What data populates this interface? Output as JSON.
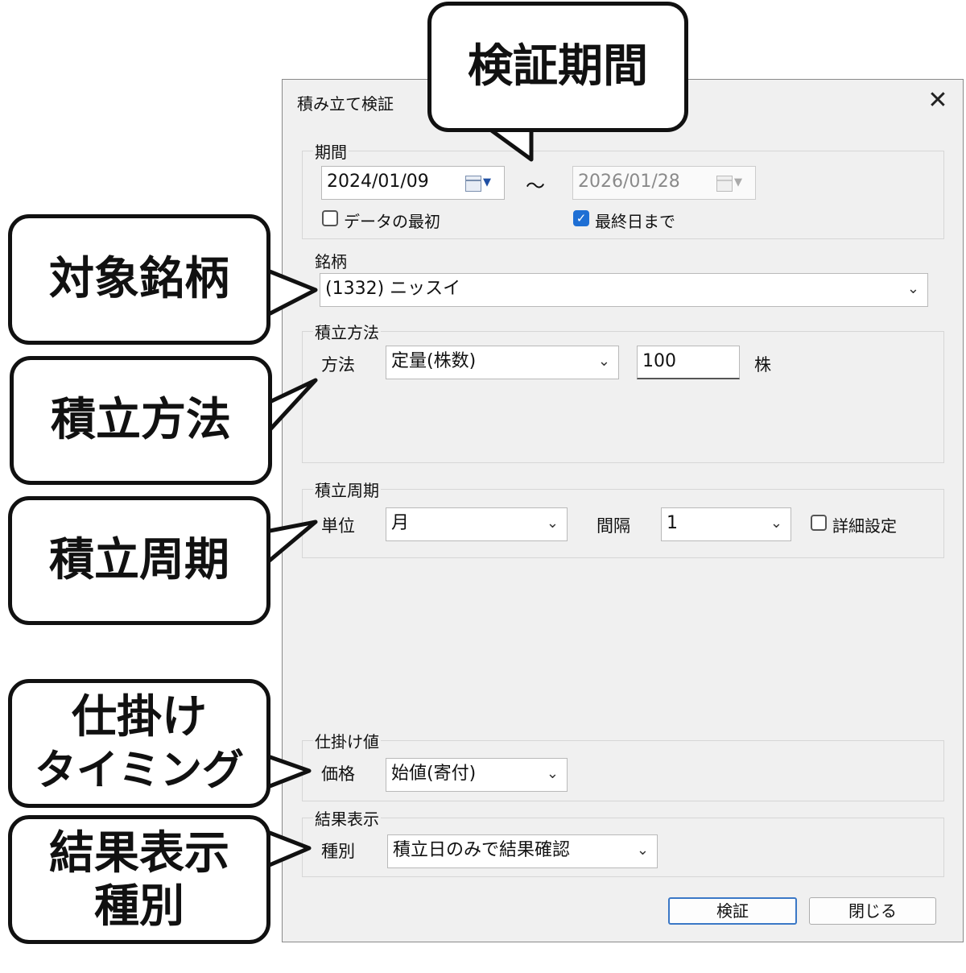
{
  "dialog": {
    "title": "積み立て検証",
    "close_glyph": "✕",
    "period": {
      "label": "期間",
      "start_date": "2024/01/09",
      "end_date": "2026/01/28",
      "tilde": "〜",
      "from_start_label": "データの最初",
      "from_start_checked": false,
      "to_last_label": "最終日まで",
      "to_last_checked": true
    },
    "stock": {
      "label": "銘柄",
      "value": "(1332) ニッスイ"
    },
    "method": {
      "label": "積立方法",
      "field_label": "方法",
      "value": "定量(株数)",
      "amount": "100",
      "unit": "株"
    },
    "cycle": {
      "label": "積立周期",
      "unit_label": "単位",
      "unit_value": "月",
      "interval_label": "間隔",
      "interval_value": "1",
      "detail_label": "詳細設定",
      "detail_checked": false
    },
    "entry": {
      "label": "仕掛け値",
      "price_label": "価格",
      "price_value": "始値(寄付)"
    },
    "result": {
      "label": "結果表示",
      "type_label": "種別",
      "type_value": "積立日のみで結果確認"
    },
    "buttons": {
      "verify": "検証",
      "close": "閉じる"
    }
  },
  "callouts": {
    "period": "検証期間",
    "stock": "対象銘柄",
    "method": "積立方法",
    "cycle": "積立周期",
    "entry_line1": "仕掛け",
    "entry_line2": "タイミング",
    "result_line1": "結果表示",
    "result_line2": "種別"
  },
  "icons": {
    "chevron": "chevron-down-icon",
    "calendar": "calendar-icon",
    "close": "close-icon"
  },
  "colors": {
    "checkbox_checked": "#1e6fd4",
    "primary_button_border": "#3b78c6",
    "dialog_bg": "#f0f0f0"
  }
}
